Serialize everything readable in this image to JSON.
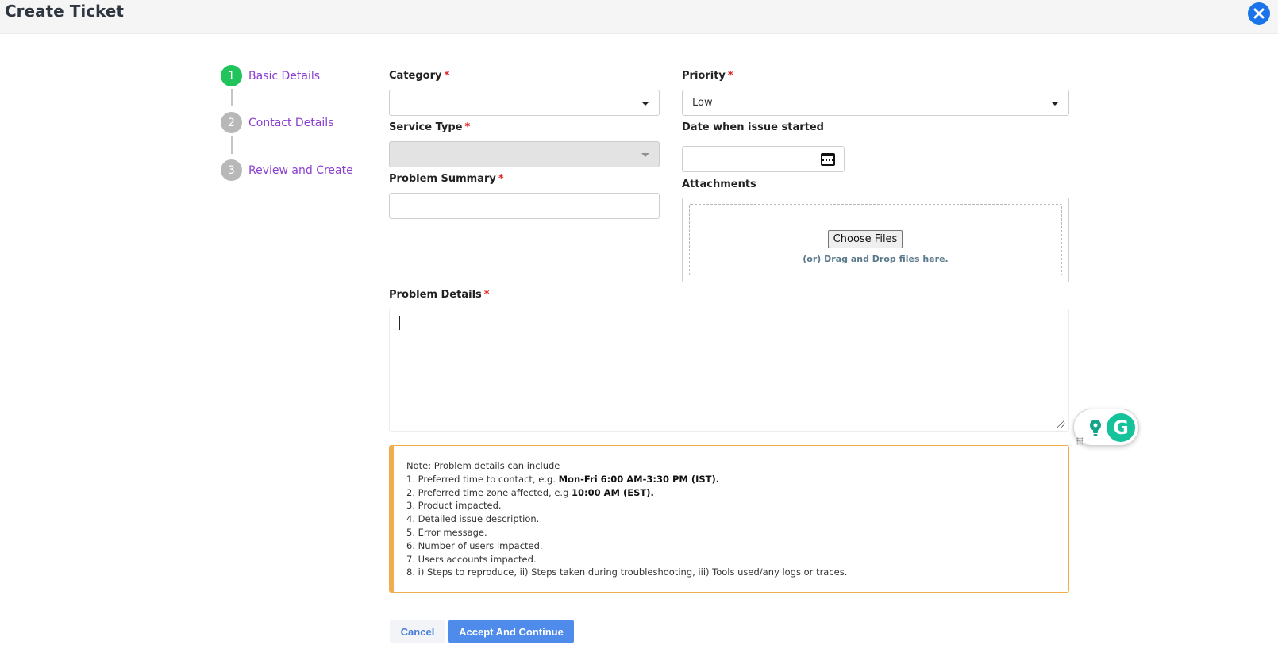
{
  "header": {
    "title": "Create Ticket",
    "close_icon": "close-circle-icon"
  },
  "stepper": {
    "steps": [
      {
        "number": "1",
        "label": "Basic Details",
        "status": "active"
      },
      {
        "number": "2",
        "label": "Contact Details",
        "status": "inactive"
      },
      {
        "number": "3",
        "label": "Review and Create",
        "status": "inactive"
      }
    ]
  },
  "form": {
    "required_marker": "*",
    "category": {
      "label": "Category",
      "value": ""
    },
    "priority": {
      "label": "Priority",
      "value": "Low"
    },
    "service_type": {
      "label": "Service Type",
      "value": ""
    },
    "date_started": {
      "label": "Date when issue started",
      "value": ""
    },
    "problem_summary": {
      "label": "Problem Summary",
      "value": ""
    },
    "attachments": {
      "label": "Attachments",
      "choose_button": "Choose Files",
      "drop_text": "(or) Drag and Drop files here."
    },
    "problem_details": {
      "label": "Problem Details",
      "value": ""
    }
  },
  "note": {
    "intro": "Note: Problem details can include",
    "items": [
      {
        "text": "1. Preferred time to contact, e.g. ",
        "bold": "Mon-Fri 6:00 AM-3:30 PM (IST)."
      },
      {
        "text": "2. Preferred time zone affected, e.g ",
        "bold": "10:00 AM (EST)."
      },
      {
        "text": "3. Product impacted.",
        "bold": ""
      },
      {
        "text": "4. Detailed issue description.",
        "bold": ""
      },
      {
        "text": "5. Error message.",
        "bold": ""
      },
      {
        "text": "6. Number of users impacted.",
        "bold": ""
      },
      {
        "text": "7. Users accounts impacted.",
        "bold": ""
      },
      {
        "text": "8. i) Steps to reproduce, ii) Steps taken during troubleshooting, iii) Tools used/any logs or traces.",
        "bold": ""
      }
    ]
  },
  "actions": {
    "cancel": "Cancel",
    "accept": "Accept And Continue"
  },
  "colors": {
    "accent_blue": "#4e8bea",
    "step_active": "#21c45a",
    "step_inactive": "#b8b8b8",
    "step_label": "#8a3fd1",
    "note_border": "#f0ad4e",
    "required": "#e02424"
  }
}
